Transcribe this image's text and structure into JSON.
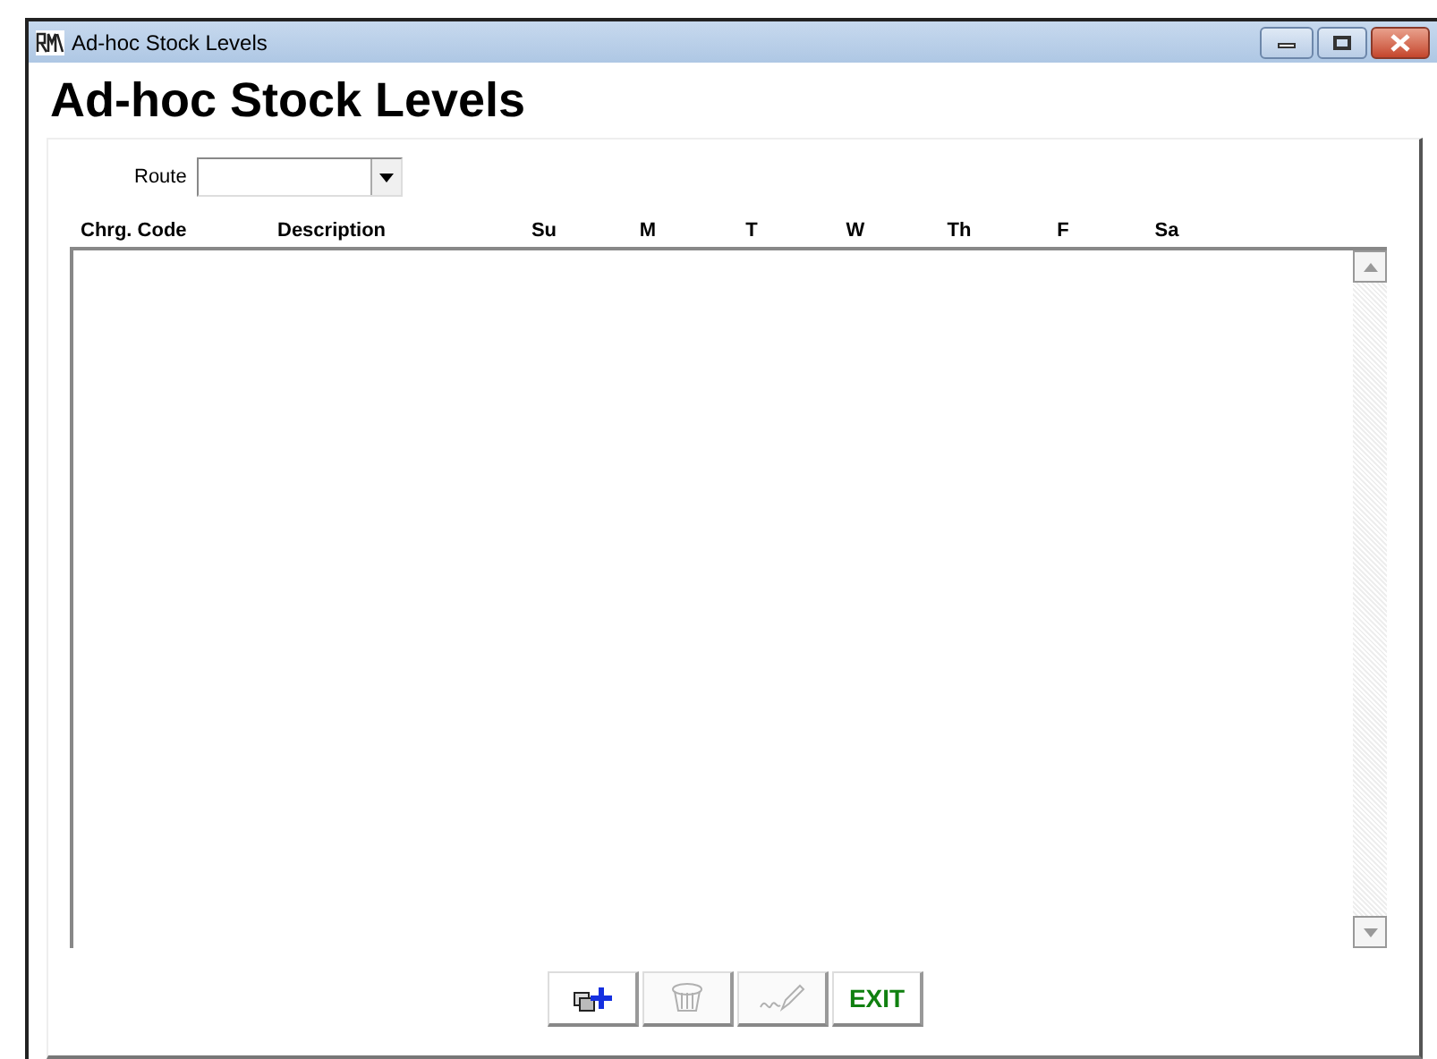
{
  "window": {
    "title": "Ad-hoc Stock Levels"
  },
  "heading": "Ad-hoc Stock Levels",
  "route": {
    "label": "Route"
  },
  "columns": [
    {
      "label": "Chrg. Code"
    },
    {
      "label": "Description"
    },
    {
      "label": "Su"
    },
    {
      "label": "M"
    },
    {
      "label": "T"
    },
    {
      "label": "W"
    },
    {
      "label": "Th"
    },
    {
      "label": "F"
    },
    {
      "label": "Sa"
    }
  ],
  "buttons": [
    {
      "kind": "add",
      "disabled": false
    },
    {
      "kind": "delete",
      "disabled": true
    },
    {
      "kind": "sign",
      "disabled": true
    },
    {
      "kind": "exit",
      "label": "EXIT",
      "disabled": false
    }
  ]
}
